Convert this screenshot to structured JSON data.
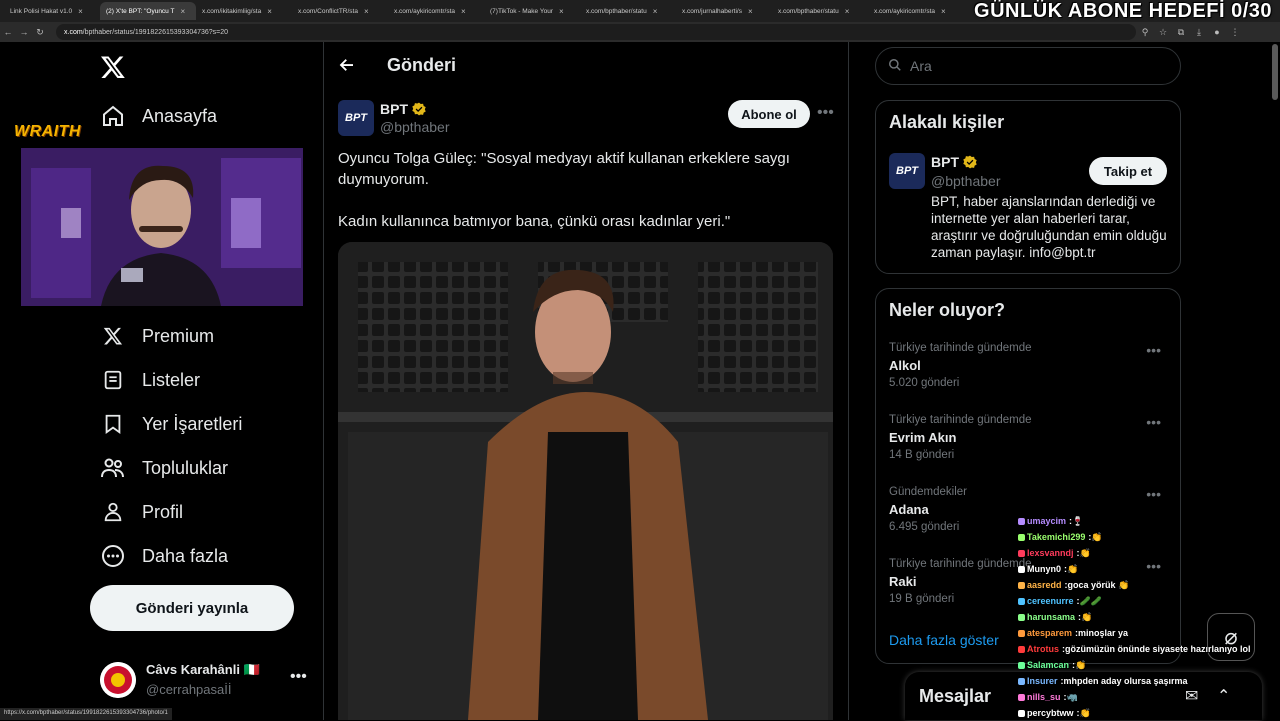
{
  "browser": {
    "tabs": [
      {
        "label": "Link Polisi Hakat v1.0",
        "active": false
      },
      {
        "label": "(2) X'te BPT: \"Oyuncu T",
        "active": true
      },
      {
        "label": "x.com/ikitakimliig/sta",
        "active": false
      },
      {
        "label": "x.com/ConflictTR/sta",
        "active": false
      },
      {
        "label": "x.com/aykiricomtr/sta",
        "active": false
      },
      {
        "label": "(7)TikTok - Make Your",
        "active": false
      },
      {
        "label": "x.com/bpthaber/statu",
        "active": false
      },
      {
        "label": "x.com/jurnalhaberti/s",
        "active": false
      },
      {
        "label": "x.com/bpthaber/statu",
        "active": false
      },
      {
        "label": "x.com/aykiricomtr/sta",
        "active": false
      }
    ],
    "url_domain": "x.com",
    "url_path": "/bpthaber/status/1991822615393304736?s=20",
    "status_url": "https://x.com/bpthaber/status/1991822615393304736/photo/1"
  },
  "overlay": {
    "goal_text": "GÜNLÜK ABONE HEDEFİ 0/30",
    "brand": "WRAITH"
  },
  "nav": {
    "items": [
      {
        "label": "Anasayfa",
        "icon": "home-icon"
      },
      {
        "label": "Premium",
        "icon": "x-icon"
      },
      {
        "label": "Listeler",
        "icon": "list-icon"
      },
      {
        "label": "Yer İşaretleri",
        "icon": "bookmark-icon"
      },
      {
        "label": "Topluluklar",
        "icon": "communities-icon"
      },
      {
        "label": "Profil",
        "icon": "profile-icon"
      },
      {
        "label": "Daha fazla",
        "icon": "more-circle-icon"
      }
    ],
    "post_button": "Gönderi yayınla",
    "account": {
      "name": "Câvs Karahânli 🇮🇹",
      "handle": "@cerrahpasaİİ"
    }
  },
  "post": {
    "header_title": "Gönderi",
    "author_name": "BPT",
    "author_handle": "@bpthaber",
    "avatar_text": "BPT",
    "subscribe_label": "Abone ol",
    "text_line1": "Oyuncu Tolga Güleç: \"Sosyal medyayı aktif kullanan erkeklere saygı duymuyorum.",
    "text_line2": "Kadın kullanınca batmıyor bana, çünkü orası kadınlar yeri.\""
  },
  "sidebar": {
    "search_placeholder": "Ara",
    "related_title": "Alakalı kişiler",
    "related": {
      "name": "BPT",
      "handle": "@bpthaber",
      "follow_label": "Takip et",
      "bio": "BPT, haber ajanslarından derlediği ve internette yer alan haberleri tarar, araştırır ve doğruluğundan emin olduğu zaman paylaşır. info@bpt.tr"
    },
    "trends_title": "Neler oluyor?",
    "trends": [
      {
        "context": "Türkiye tarihinde gündemde",
        "name": "Alkol",
        "count": "5.020 gönderi"
      },
      {
        "context": "Türkiye tarihinde gündemde",
        "name": "Evrim Akın",
        "count": "14 B gönderi"
      },
      {
        "context": "Gündemdekiler",
        "name": "Adana",
        "count": "6.495 gönderi"
      },
      {
        "context": "Türkiye tarihinde gündemde",
        "name": "Raki",
        "count": "19 B gönderi"
      }
    ],
    "show_more": "Daha fazla göster",
    "messages_label": "Mesajlar"
  },
  "chat": [
    {
      "user": "umaycim",
      "msg": "🍷",
      "color": "#b58cff"
    },
    {
      "user": "Takemichi299",
      "msg": "👏",
      "color": "#9aff6e"
    },
    {
      "user": "lexsvanndj",
      "msg": "👏",
      "color": "#ff3b5c"
    },
    {
      "user": "Munyn0",
      "msg": "👏",
      "color": "#ffffff"
    },
    {
      "user": "aasredd",
      "msg": "goca yörük 👏",
      "color": "#ffb347"
    },
    {
      "user": "cereenurre",
      "msg": "🥒🥒",
      "color": "#4fc3ff"
    },
    {
      "user": "harunsama",
      "msg": "👏",
      "color": "#8bff8b"
    },
    {
      "user": "atesparem",
      "msg": "minoşlar ya",
      "color": "#ff9a3c"
    },
    {
      "user": "Atrotus",
      "msg": "gözümüzün önünde siyasete hazırlanıyo lol",
      "color": "#ff3b3b"
    },
    {
      "user": "Salamcan",
      "msg": "👏",
      "color": "#6cff9a"
    },
    {
      "user": "Insurer",
      "msg": "mhpden aday olursa şaşırma",
      "color": "#7ab8ff"
    },
    {
      "user": "nills_su",
      "msg": "🦏",
      "color": "#ff7ad9"
    },
    {
      "user": "percybtww",
      "msg": "👏",
      "color": "#ffffff"
    }
  ]
}
